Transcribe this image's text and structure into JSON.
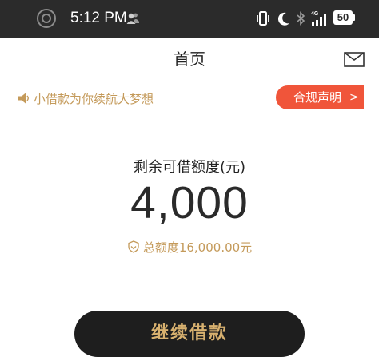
{
  "status_bar": {
    "time": "5:12 PM",
    "network": "4G",
    "battery": "50",
    "icons": [
      "record-icon",
      "contacts-icon",
      "vibrate-icon",
      "moon-icon",
      "bluetooth-icon",
      "signal-icon",
      "battery-icon"
    ]
  },
  "header": {
    "title": "首页",
    "mail_icon": "mail-icon"
  },
  "notice": {
    "text": "小借款为你续航大梦想",
    "icon": "speaker-icon"
  },
  "compliance_button": {
    "label": "合规声明",
    "chevron": ">"
  },
  "credit": {
    "label": "剩余可借额度(元)",
    "amount": "4,000",
    "total_text": "总额度16,000.00元",
    "total_icon": "shield-icon"
  },
  "actions": {
    "continue_label": "继续借款"
  },
  "colors": {
    "status_bar": "#2b2b2b",
    "gold": "#c49a5a",
    "accent_red": "#f0553a",
    "button_bg": "#1e1e1e",
    "button_text": "#d8b16f"
  }
}
